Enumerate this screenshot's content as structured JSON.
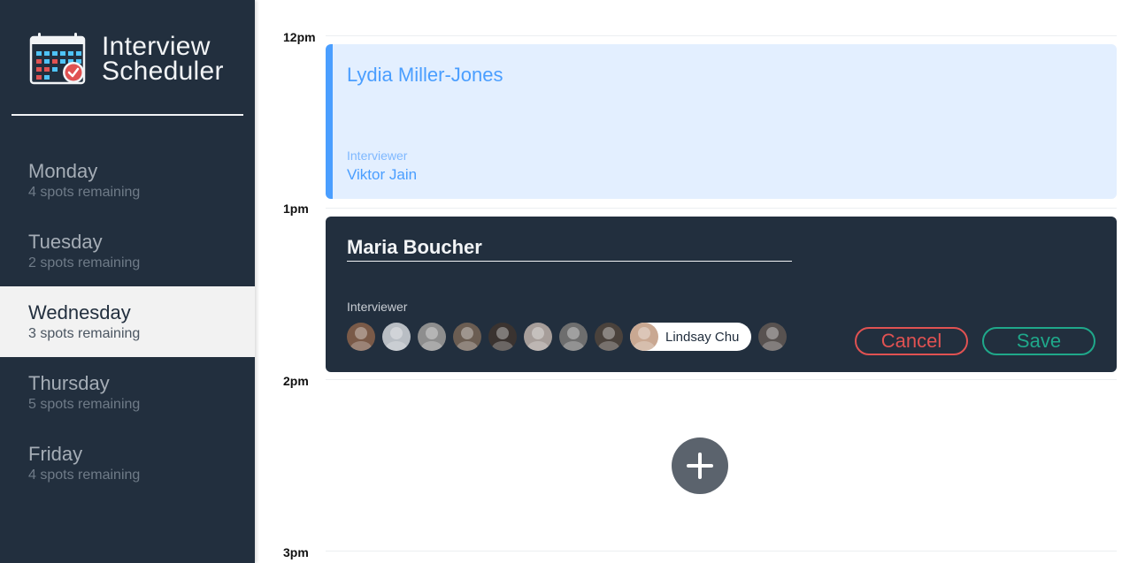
{
  "brand": {
    "title_line1": "Interview",
    "title_line2": "Scheduler",
    "icon": "calendar-check-icon"
  },
  "days": [
    {
      "name": "Monday",
      "spots": "4 spots remaining",
      "selected": false
    },
    {
      "name": "Tuesday",
      "spots": "2 spots remaining",
      "selected": false
    },
    {
      "name": "Wednesday",
      "spots": "3 spots remaining",
      "selected": true
    },
    {
      "name": "Thursday",
      "spots": "5 spots remaining",
      "selected": false
    },
    {
      "name": "Friday",
      "spots": "4 spots remaining",
      "selected": false
    }
  ],
  "times": [
    "12pm",
    "1pm",
    "2pm",
    "3pm"
  ],
  "appointment_show": {
    "student": "Lydia Miller-Jones",
    "interviewer_label": "Interviewer",
    "interviewer_name": "Viktor Jain"
  },
  "appointment_form": {
    "student_value": "Maria Boucher",
    "interviewer_label": "Interviewer",
    "selected_interviewer": "Lindsay Chu",
    "cancel_label": "Cancel",
    "save_label": "Save"
  },
  "add_button_icon": "plus-icon",
  "colors": {
    "sidebar_bg": "#222f3e",
    "accent_blue": "#4a9eff",
    "show_bg": "#e3efff",
    "danger": "#e05252",
    "success": "#1fa88a"
  }
}
